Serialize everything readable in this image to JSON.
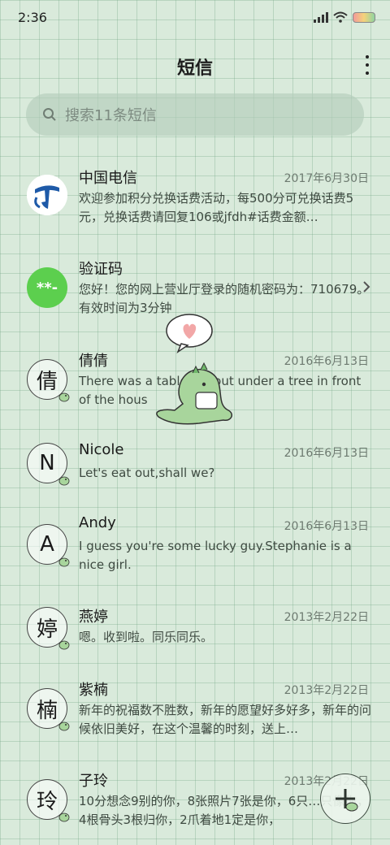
{
  "status_bar": {
    "time": "2:36"
  },
  "header": {
    "title": "短信"
  },
  "search": {
    "placeholder": "搜索11条短信"
  },
  "conversations": [
    {
      "name": "中国电信",
      "date": "2017年6月30日",
      "preview": "欢迎参加积分兑换话费活动，每500分可兑换话费5元，兑换话费请回复106或jfdh#话费金额…",
      "avatar": "telecom-logo"
    },
    {
      "name": "验证码",
      "date": "",
      "preview": "您好！您的网上营业厅登录的随机密码为：710679。有效时间为3分钟",
      "avatar_text": "**-"
    },
    {
      "name": "倩倩",
      "date": "2016年6月13日",
      "preview": "There was a table set out under a tree in front of the hous",
      "avatar_text": "倩"
    },
    {
      "name": "Nicole",
      "date": "2016年6月13日",
      "preview": "Let's eat out,shall we?",
      "avatar_text": "N"
    },
    {
      "name": "Andy",
      "date": "2016年6月13日",
      "preview": "I guess you're some lucky guy.Stephanie is a nice girl.",
      "avatar_text": "A"
    },
    {
      "name": "燕婷",
      "date": "2013年2月22日",
      "preview": "嗯。收到啦。同乐同乐。",
      "avatar_text": "婷"
    },
    {
      "name": "紫楠",
      "date": "2013年2月22日",
      "preview": "新年的祝福数不胜数，新年的愿望好多好多，新年的问候依旧美好，在这个温馨的时刻，送上…",
      "avatar_text": "楠"
    },
    {
      "name": "子玲",
      "date": "2013年2月22日",
      "preview": "10分想念9别的你，8张照片7张是你，6只…只像你，4根骨头3根归你，2爪着地1定是你，",
      "avatar_text": "玲"
    }
  ],
  "icons": {
    "search": "search-icon",
    "more": "more-vert-icon",
    "chevron": "chevron-right-icon",
    "fab": "plus-icon",
    "sticker": "dinosaur-heart-sticker"
  },
  "colors": {
    "background": "#d9eadb",
    "grid": "#9cc3a6",
    "verify_avatar": "#5ccf4e",
    "telecom_blue": "#1e5aa8"
  }
}
